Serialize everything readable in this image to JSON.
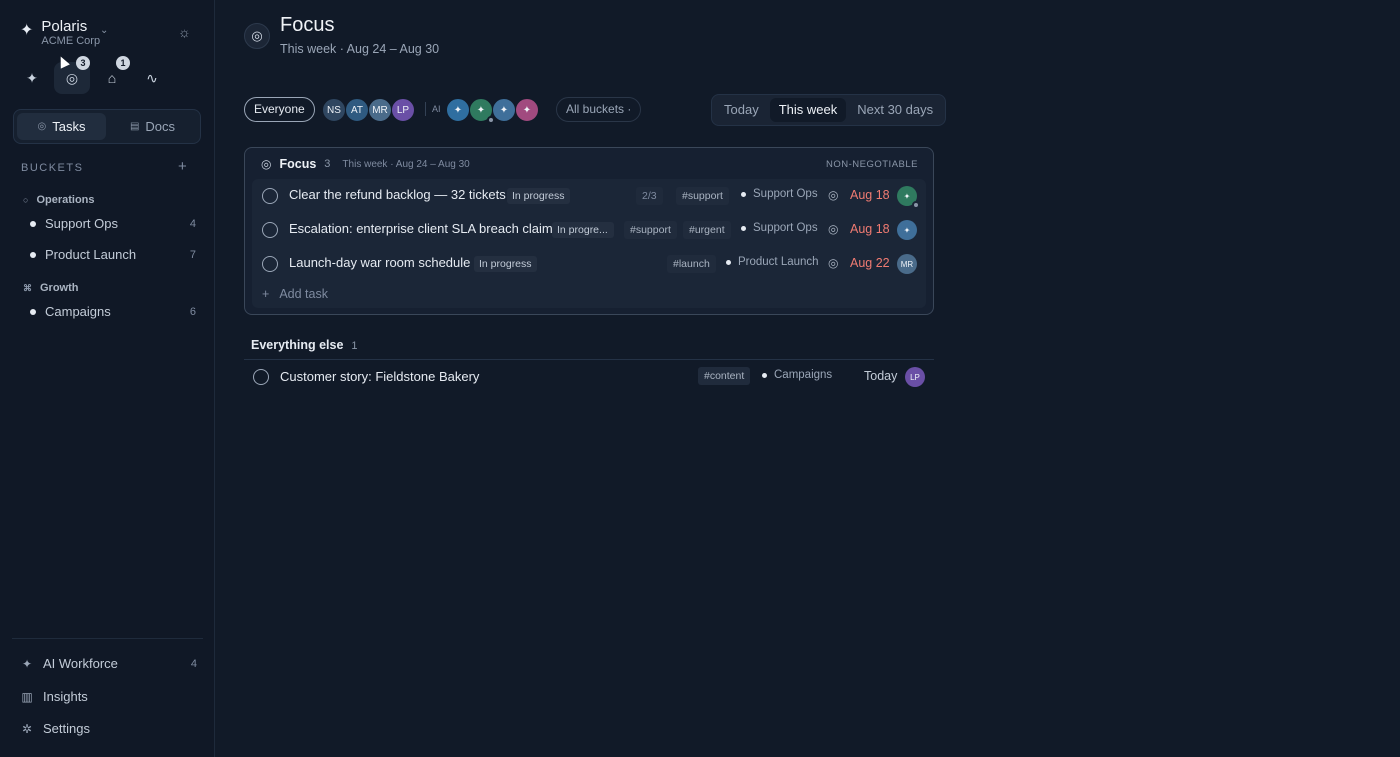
{
  "brand": {
    "name": "Polaris",
    "org": "ACME Corp"
  },
  "top_icons": [
    {
      "icon": "sparkle-icon",
      "glyph": "✦"
    },
    {
      "icon": "focus-target-icon",
      "glyph": "◎",
      "badge": "3"
    },
    {
      "icon": "inbox-icon",
      "glyph": "⌂",
      "badge": "1"
    },
    {
      "icon": "activity-icon",
      "glyph": "∿"
    }
  ],
  "view_toggle": {
    "tasks": "Tasks",
    "docs": "Docs"
  },
  "buckets": {
    "header": "BUCKETS",
    "groups": [
      {
        "name": "Operations",
        "items": [
          {
            "name": "Support Ops",
            "count": "4"
          },
          {
            "name": "Product Launch",
            "count": "7"
          }
        ]
      },
      {
        "name": "Growth",
        "items": [
          {
            "name": "Campaigns",
            "count": "6"
          }
        ]
      }
    ]
  },
  "nav": [
    {
      "label": "AI Workforce",
      "count": "4",
      "icon": "sparkle-icon"
    },
    {
      "label": "Insights",
      "count": "",
      "icon": "bar-chart-icon"
    },
    {
      "label": "Settings",
      "count": "",
      "icon": "gear-icon"
    }
  ],
  "header": {
    "title": "Focus",
    "subtitle": "This week · Aug 24 – Aug 30"
  },
  "filters": {
    "everyone": "Everyone",
    "people": [
      {
        "initials": "NS",
        "color": "#2f4660"
      },
      {
        "initials": "AT",
        "color": "#2f5a80"
      },
      {
        "initials": "MR",
        "color": "#4a6b8a"
      },
      {
        "initials": "LP",
        "color": "#6a4fa6"
      }
    ],
    "ai_label": "AI",
    "ai_agents": [
      {
        "color": "#2f6ea0"
      },
      {
        "color": "#2f7a5f",
        "online": true
      },
      {
        "color": "#3f6f9a"
      },
      {
        "color": "#a14a7f"
      }
    ],
    "all_buckets": "All buckets ·",
    "ranges": [
      "Today",
      "This week",
      "Next 30 days"
    ],
    "active_range": "This week"
  },
  "focus": {
    "title": "Focus",
    "count": "3",
    "range": "This week · Aug 24 – Aug 30",
    "flag": "NON-NEGOTIABLE",
    "add_task": "Add task",
    "tasks": [
      {
        "title": "Clear the refund backlog — 32 tickets",
        "status": "In progress",
        "subtasks": "2/3",
        "tags": [
          "#support"
        ],
        "bucket": "Support Ops",
        "due": "Aug 18",
        "assignee": "✦",
        "assignee_color": "#2f7a5f"
      },
      {
        "title": "Escalation: enterprise client SLA breach claim",
        "status": "In progre...",
        "subtasks": "",
        "tags": [
          "#support",
          "#urgent"
        ],
        "bucket": "Support Ops",
        "due": "Aug 18",
        "assignee": "✦",
        "assignee_color": "#3f6f9a"
      },
      {
        "title": "Launch-day war room schedule",
        "status": "In progress",
        "subtasks": "",
        "tags": [
          "#launch"
        ],
        "bucket": "Product Launch",
        "due": "Aug 22",
        "assignee": "MR",
        "assignee_color": "#4a6b8a"
      }
    ]
  },
  "everything_else": {
    "title": "Everything else",
    "count": "1",
    "tasks": [
      {
        "title": "Customer story: Fieldstone Bakery",
        "tags": [
          "#content"
        ],
        "bucket": "Campaigns",
        "due": "Today",
        "assignee": "LP",
        "assignee_color": "#6a4fa6"
      }
    ]
  }
}
